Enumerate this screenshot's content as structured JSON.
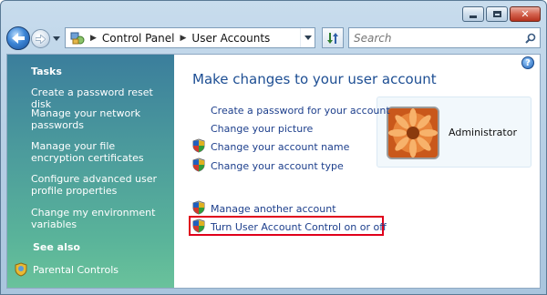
{
  "window": {
    "caption_buttons": {
      "minimize": "minimize-icon",
      "maximize": "maximize-icon",
      "close": "close-icon"
    }
  },
  "nav": {
    "breadcrumb": [
      "Control Panel",
      "User Accounts"
    ],
    "search_placeholder": "Search"
  },
  "sidebar": {
    "tasks_heading": "Tasks",
    "tasks": [
      "Create a password reset disk",
      "Manage your network passwords",
      "Manage your file encryption certificates",
      "Configure advanced user profile properties",
      "Change my environment variables"
    ],
    "see_also_heading": "See also",
    "see_also": [
      "Parental Controls"
    ]
  },
  "main": {
    "title": "Make changes to your user account",
    "links": [
      {
        "label": "Create a password for your account",
        "shield": false
      },
      {
        "label": "Change your picture",
        "shield": false
      },
      {
        "label": "Change your account name",
        "shield": true
      },
      {
        "label": "Change your account type",
        "shield": true
      },
      {
        "label": "Manage another account",
        "shield": true
      },
      {
        "label": "Turn User Account Control on or off",
        "shield": true
      }
    ],
    "account_name": "Administrator",
    "help_label": "?"
  },
  "colors": {
    "highlight": "#e0001b",
    "link": "#1d3f8c",
    "title": "#1d4e93"
  }
}
